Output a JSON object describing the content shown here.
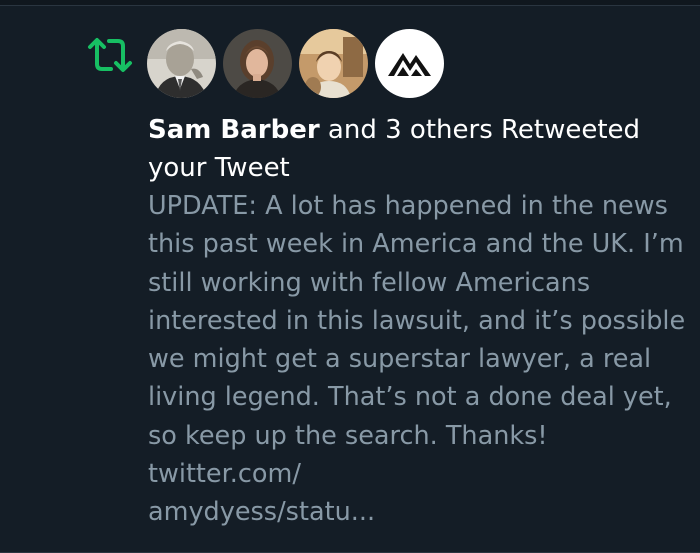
{
  "notification": {
    "type": "retweet",
    "icon": "retweet-icon",
    "accent_color": "#17bf63",
    "avatars": [
      {
        "icon": "avatar-old-man-photo"
      },
      {
        "icon": "avatar-woman-photo"
      },
      {
        "icon": "avatar-child-photo"
      },
      {
        "icon": "avatar-mountain-logo"
      }
    ],
    "actor_name": "Sam Barber",
    "action_text": " and 3 others Retweeted your Tweet",
    "tweet_text": "UPDATE: A lot has happened in the news this past week in America and the UK. I’m still working with fellow Americans interested in this lawsuit, and it’s possible we might get a superstar lawyer, a real living legend. That’s not a done deal yet, so keep up the search. Thanks! twitter.com/\namydyess/statu..."
  },
  "colors": {
    "background": "#141d26",
    "primary_text": "#ffffff",
    "secondary_text": "#8899a6"
  }
}
